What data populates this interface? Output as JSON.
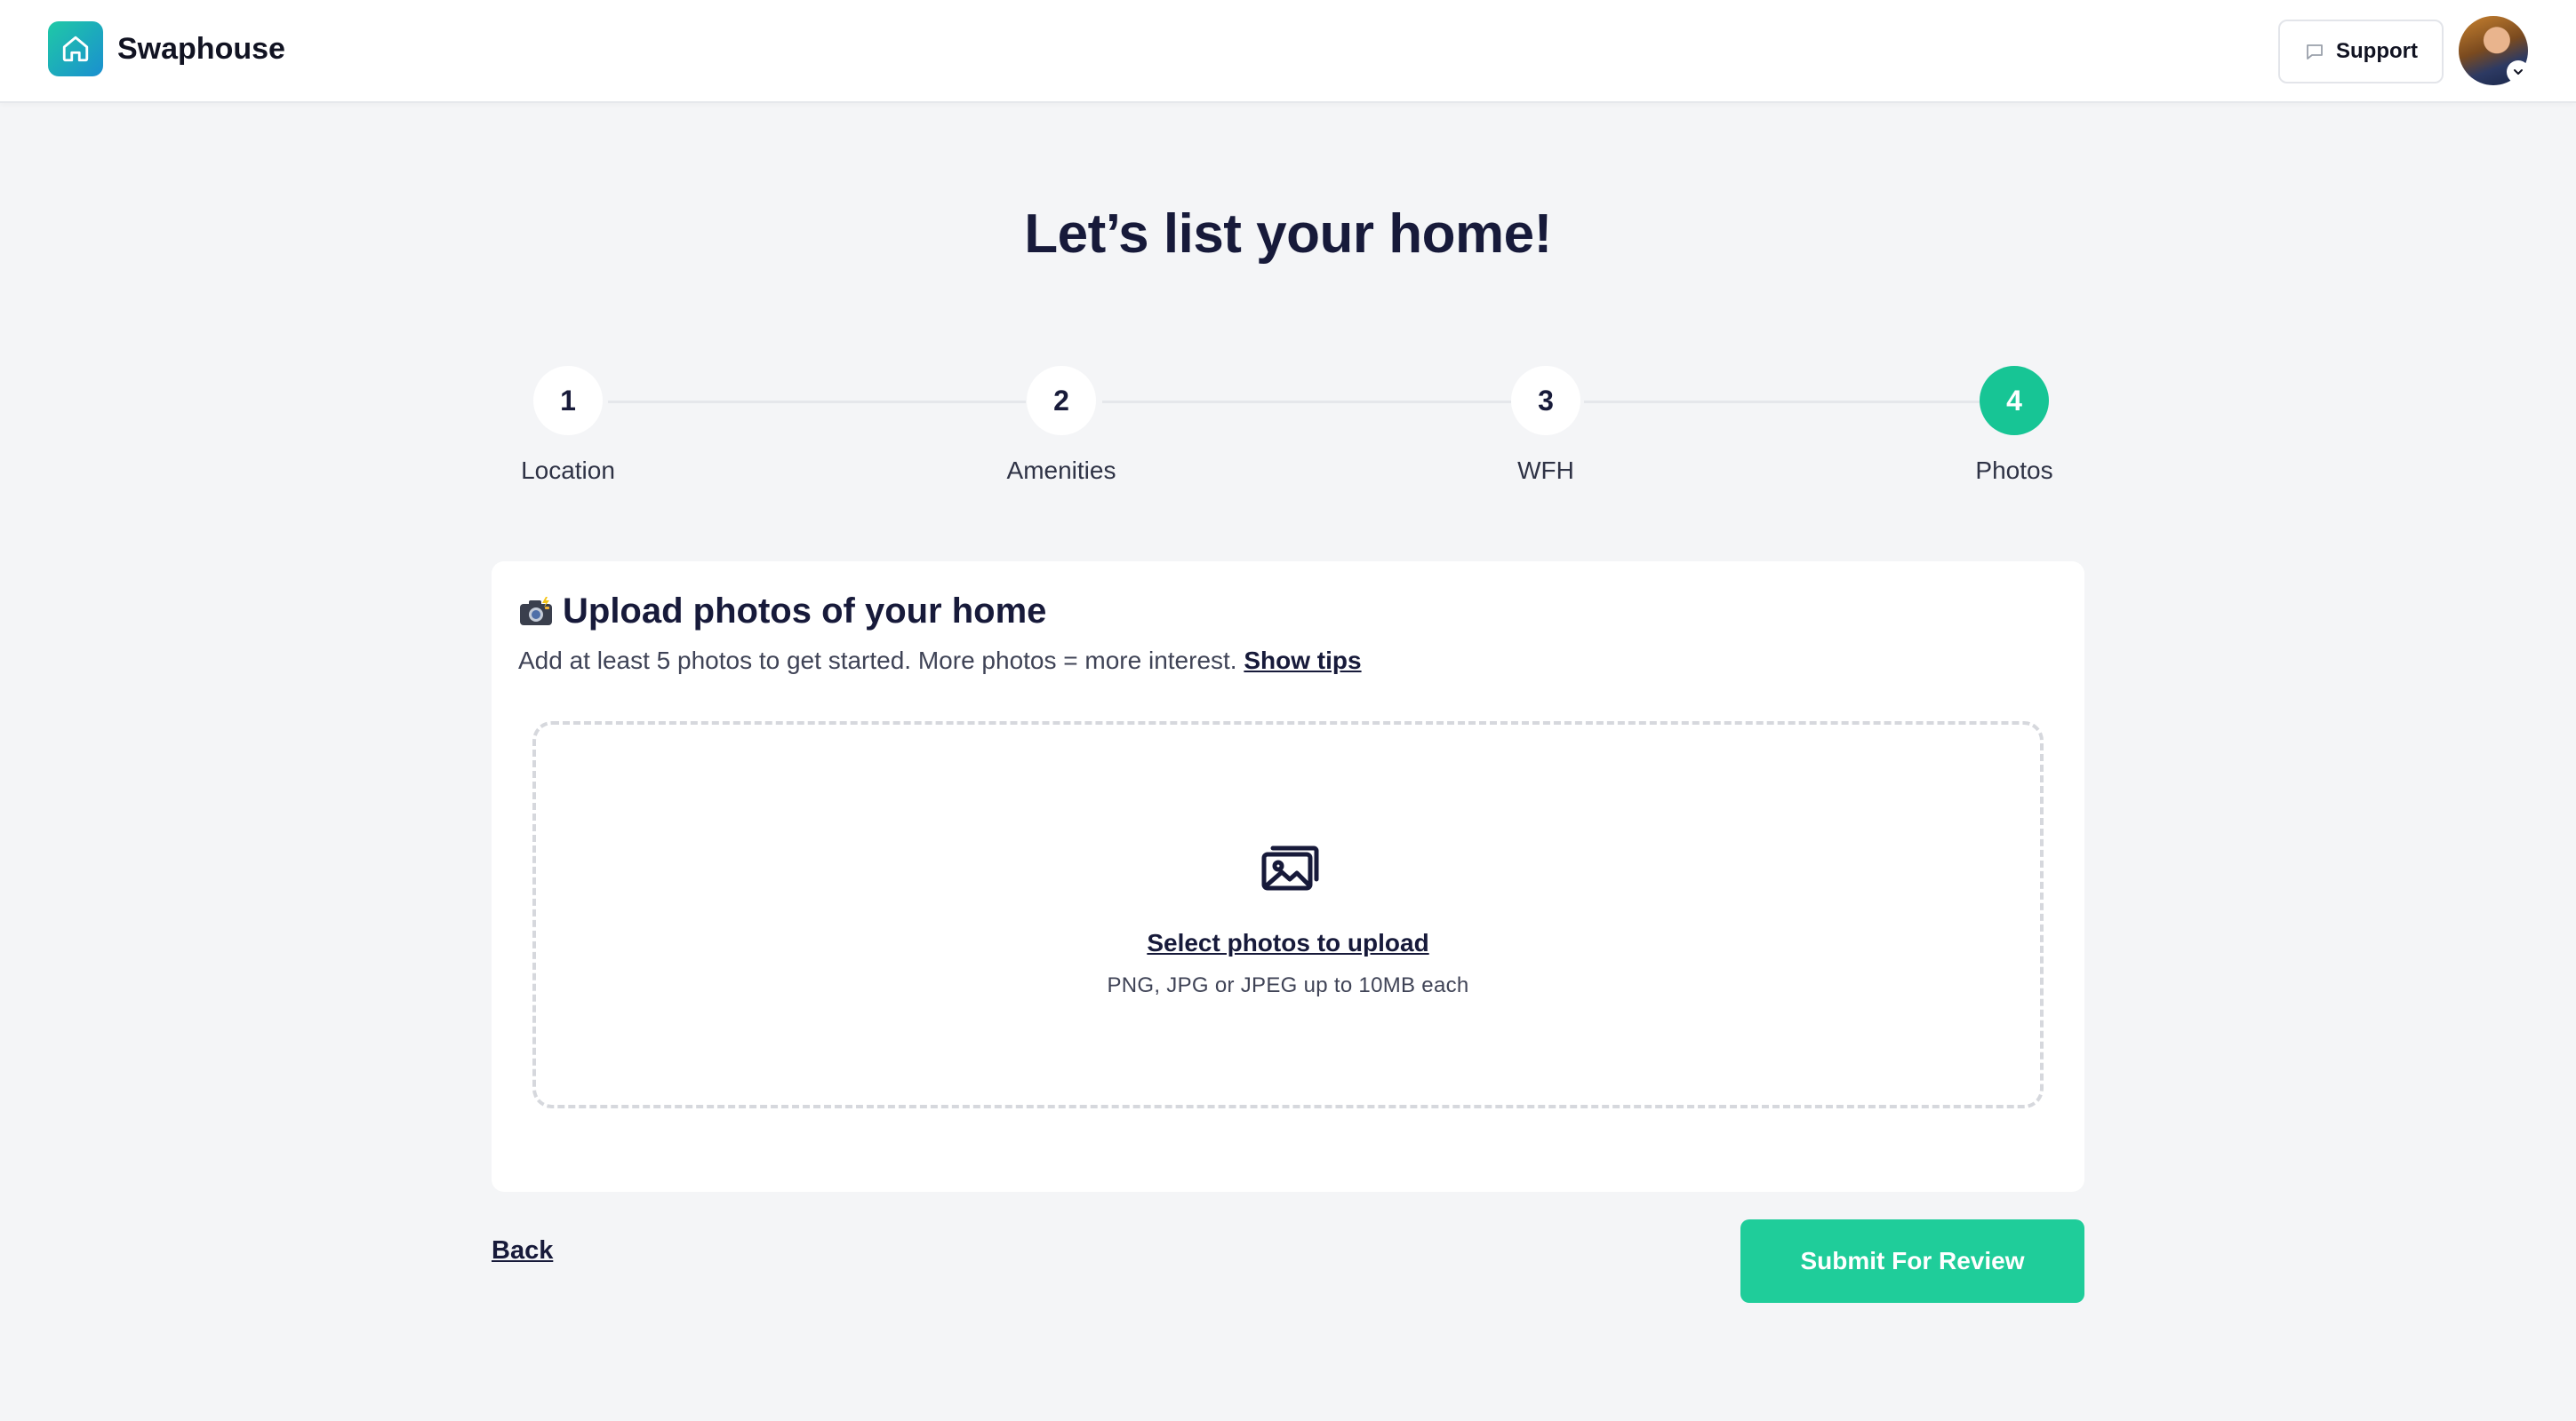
{
  "header": {
    "brand_name": "Swaphouse",
    "support_label": "Support",
    "accent": "#17c595"
  },
  "page": {
    "title": "Let’s list your home!"
  },
  "stepper": {
    "current_step": 4,
    "steps": [
      {
        "number": "1",
        "label": "Location"
      },
      {
        "number": "2",
        "label": "Amenities"
      },
      {
        "number": "3",
        "label": "WFH"
      },
      {
        "number": "4",
        "label": "Photos"
      }
    ]
  },
  "upload": {
    "title": "Upload photos of your home",
    "icon": "camera-flash-icon",
    "subtitle": "Add at least 5 photos to get started. More photos = more interest.",
    "tips_link": "Show tips",
    "dropzone_link": "Select photos to upload",
    "dropzone_hint": "PNG, JPG or JPEG up to 10MB each",
    "dropzone_icon": "photos-icon"
  },
  "actions": {
    "back_label": "Back",
    "submit_label": "Submit For Review",
    "submit_color": "#1fcd9a"
  }
}
